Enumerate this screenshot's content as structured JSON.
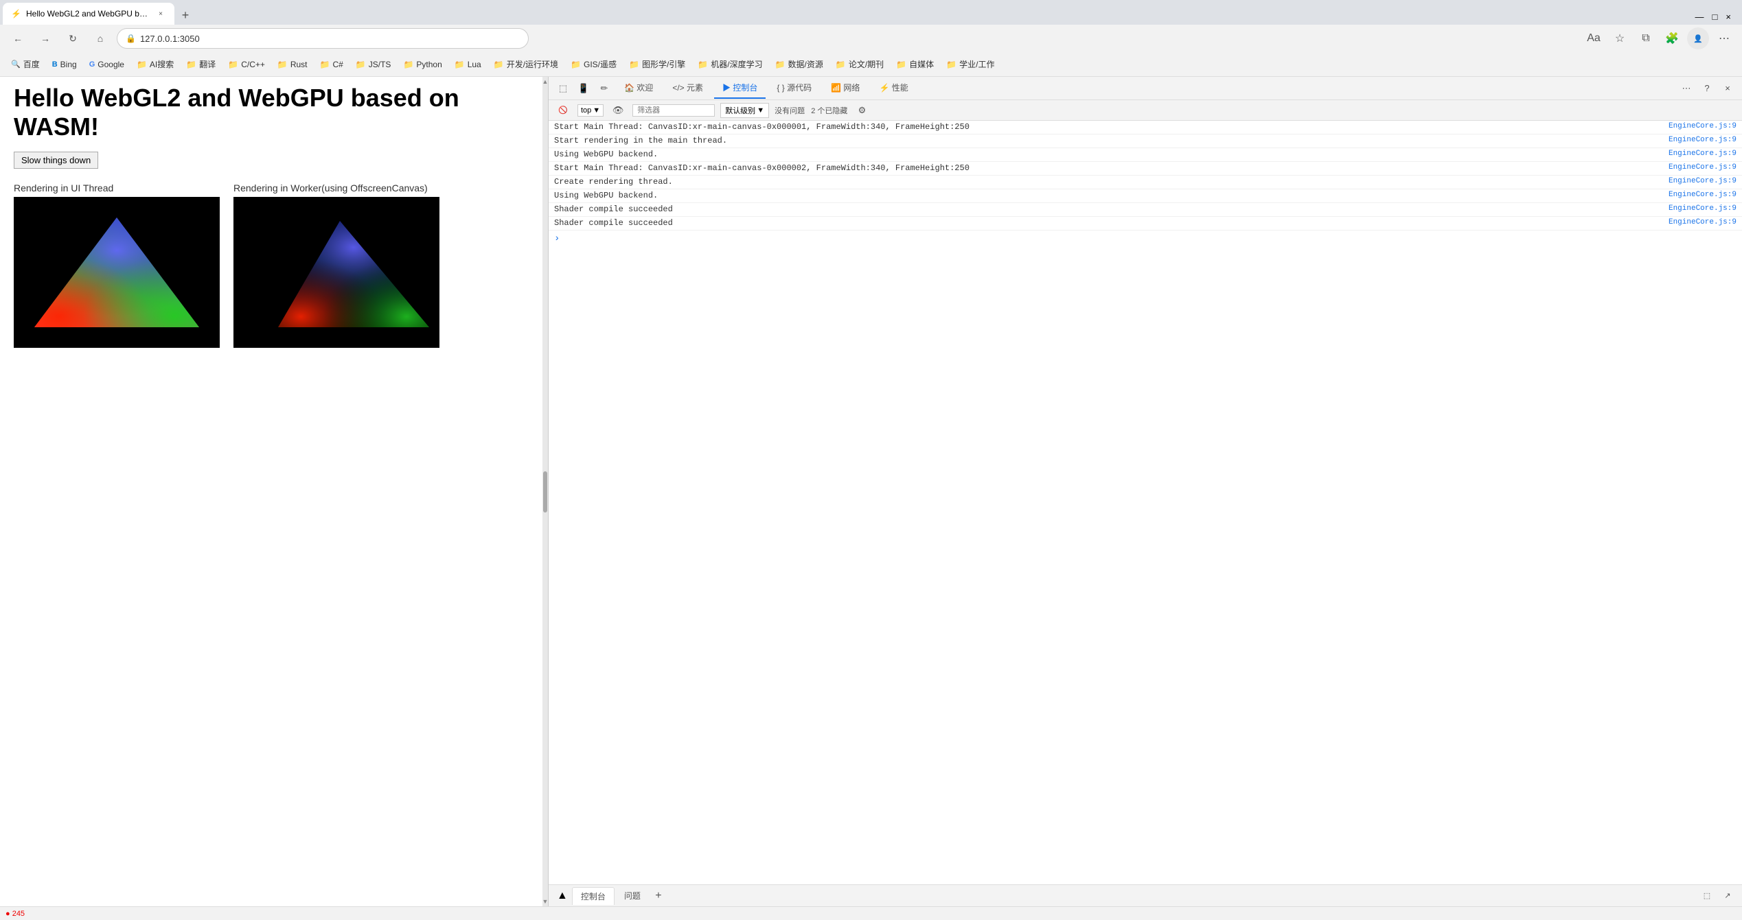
{
  "browser": {
    "address": "127.0.0.1:3050",
    "tab_title": "Hello WebGL2 and WebGPU ba..."
  },
  "bookmarks": [
    {
      "label": "百度",
      "icon": "🔍"
    },
    {
      "label": "Bing",
      "icon": "B"
    },
    {
      "label": "Google",
      "icon": "G"
    },
    {
      "label": "AI搜索",
      "icon": "📁"
    },
    {
      "label": "翻译",
      "icon": "📁"
    },
    {
      "label": "C/C++",
      "icon": "📁"
    },
    {
      "label": "Rust",
      "icon": "📁"
    },
    {
      "label": "C#",
      "icon": "📁"
    },
    {
      "label": "JS/TS",
      "icon": "📁"
    },
    {
      "label": "Python",
      "icon": "📁"
    },
    {
      "label": "Lua",
      "icon": "📁"
    },
    {
      "label": "开发/运行环境",
      "icon": "📁"
    },
    {
      "label": "GIS/遥感",
      "icon": "📁"
    },
    {
      "label": "图形学/引擎",
      "icon": "📁"
    },
    {
      "label": "机器/深度学习",
      "icon": "📁"
    },
    {
      "label": "数据/资源",
      "icon": "📁"
    },
    {
      "label": "论文/期刊",
      "icon": "📁"
    },
    {
      "label": "自媒体",
      "icon": "📁"
    },
    {
      "label": "学业/工作",
      "icon": "📁"
    }
  ],
  "webpage": {
    "title": "Hello WebGL2 and WebGPU based on WASM!",
    "slow_button": "Slow things down",
    "canvas1_label": "Rendering in UI Thread",
    "canvas2_label": "Rendering in Worker(using OffscreenCanvas)"
  },
  "devtools": {
    "tabs": [
      {
        "label": "欢迎",
        "icon": "🏠"
      },
      {
        "label": "元素",
        "icon": "</>"
      },
      {
        "label": "控制台",
        "icon": "▶",
        "active": true
      },
      {
        "label": "源代码",
        "icon": "{ }"
      },
      {
        "label": "网络",
        "icon": "📡"
      },
      {
        "label": "性能",
        "icon": "⚡"
      }
    ],
    "console": {
      "context": "top",
      "filter_placeholder": "筛选器",
      "level": "默认级别",
      "status": "没有问题",
      "hidden_count": "2 个已隐藏",
      "messages": [
        {
          "text": "Start Main Thread: CanvasID:xr-main-canvas-0x000001, FrameWidth:340, FrameHeight:250",
          "source": "EngineCore.js:9"
        },
        {
          "text": "Start rendering in the main thread.",
          "source": "EngineCore.js:9"
        },
        {
          "text": "Using WebGPU backend.",
          "source": "EngineCore.js:9"
        },
        {
          "text": "Start Main Thread: CanvasID:xr-main-canvas-0x000002, FrameWidth:340, FrameHeight:250",
          "source": "EngineCore.js:9"
        },
        {
          "text": "Create rendering thread.",
          "source": "EngineCore.js:9"
        },
        {
          "text": "Using WebGPU backend.",
          "source": "EngineCore.js:9"
        },
        {
          "text": "Shader compile succeeded",
          "source": "EngineCore.js:9"
        },
        {
          "text": "Shader compile succeeded",
          "source": "EngineCore.js:9"
        }
      ]
    },
    "bottom_tabs": [
      {
        "label": "控制台",
        "active": true
      },
      {
        "label": "问题"
      }
    ]
  },
  "icons": {
    "back": "←",
    "forward": "→",
    "refresh": "↻",
    "home": "⌂",
    "lock": "🔒",
    "star": "☆",
    "extensions": "🧩",
    "menu": "⋯",
    "close_tab": "×",
    "new_tab": "+",
    "inspect": "⬚",
    "device": "📱",
    "console_clear": "🚫",
    "scroll_top": "▲",
    "scroll_bottom": "▼",
    "caret": ">",
    "gear": "⚙"
  }
}
